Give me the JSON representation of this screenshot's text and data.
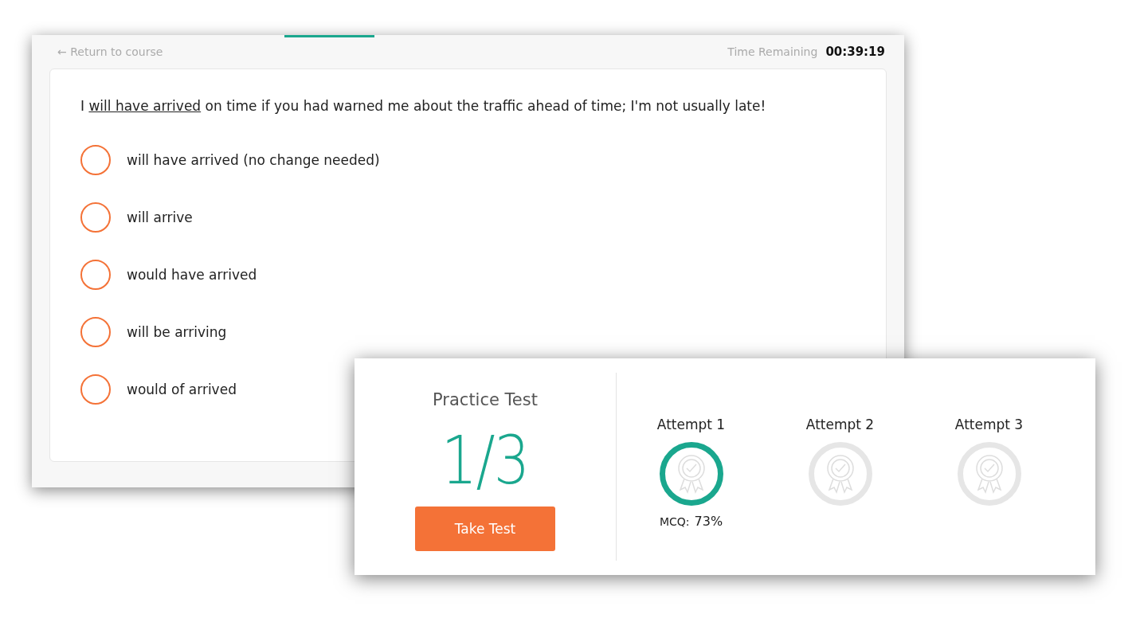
{
  "quiz": {
    "back_link": "← Return to course",
    "timer_label": "Time Remaining",
    "timer_value": "00:39:19",
    "question": {
      "before": "I ",
      "underlined": "will have arrived",
      "after": " on time if you had warned me about the traffic ahead of time; I'm not usually late!"
    },
    "options": [
      {
        "label": "will have arrived (no change needed)",
        "selected": false
      },
      {
        "label": "will arrive",
        "selected": false
      },
      {
        "label": "would have arrived",
        "selected": false
      },
      {
        "label": "will be arriving",
        "selected": false
      },
      {
        "label": "would of arrived",
        "selected": false
      }
    ]
  },
  "practice": {
    "title": "Practice Test",
    "count": "1/3",
    "button": "Take Test",
    "attempts": [
      {
        "label": "Attempt 1",
        "completed": true,
        "score_label": "MCQ:",
        "score_value": "73%"
      },
      {
        "label": "Attempt 2",
        "completed": false
      },
      {
        "label": "Attempt 3",
        "completed": false
      }
    ]
  }
}
